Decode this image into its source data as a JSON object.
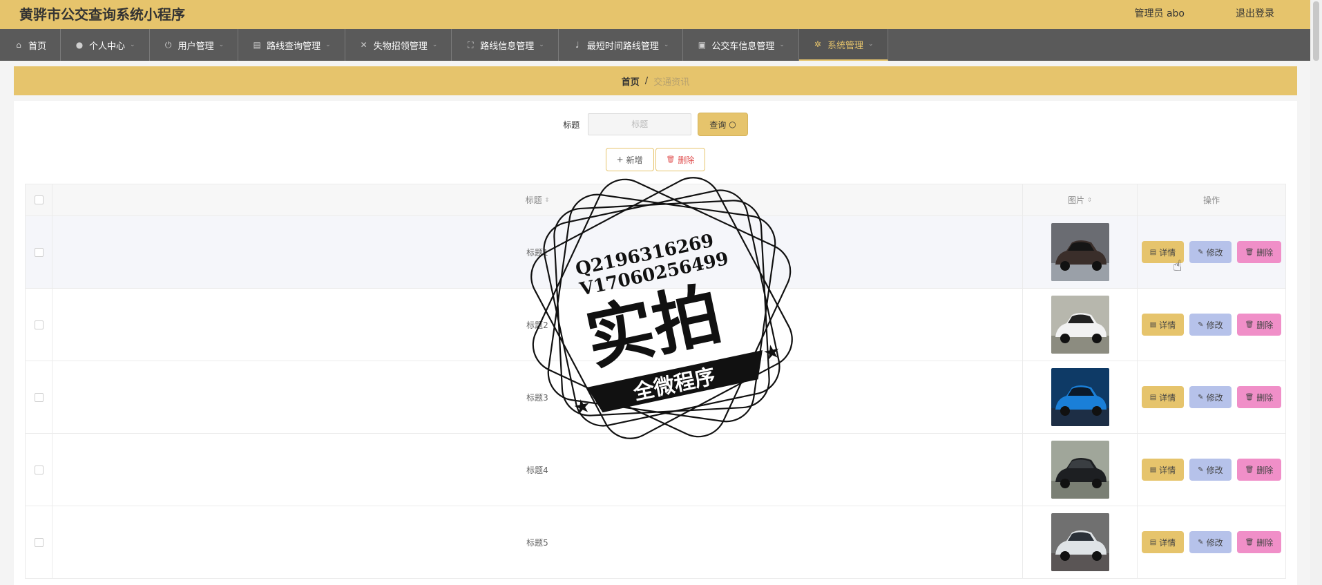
{
  "header": {
    "title": "黄骅市公交查询系统小程序",
    "user": "管理员 abo",
    "logout": "退出登录"
  },
  "nav": [
    {
      "label": "首页",
      "icon": "home-icon",
      "glyph": "⌂",
      "chevron": false,
      "active": false
    },
    {
      "label": "个人中心",
      "icon": "user-icon",
      "glyph": "●",
      "chevron": true,
      "active": false
    },
    {
      "label": "用户管理",
      "icon": "power-icon",
      "glyph": "⏻",
      "chevron": true,
      "active": false
    },
    {
      "label": "路线查询管理",
      "icon": "briefcase-icon",
      "glyph": "▤",
      "chevron": true,
      "active": false
    },
    {
      "label": "失物招领管理",
      "icon": "bell-off-icon",
      "glyph": "✕",
      "chevron": true,
      "active": false
    },
    {
      "label": "路线信息管理",
      "icon": "fullscreen-icon",
      "glyph": "⛶",
      "chevron": true,
      "active": false
    },
    {
      "label": "最短时间路线管理",
      "icon": "microphone-icon",
      "glyph": "♩",
      "chevron": true,
      "active": false
    },
    {
      "label": "公交车信息管理",
      "icon": "suitcase-icon",
      "glyph": "▣",
      "chevron": true,
      "active": false
    },
    {
      "label": "系统管理",
      "icon": "setting-icon",
      "glyph": "✲",
      "chevron": true,
      "active": true
    }
  ],
  "breadcrumb": {
    "home": "首页",
    "sep": "/",
    "current": "交通资讯"
  },
  "search": {
    "label": "标题",
    "placeholder": "标题",
    "button": "查询"
  },
  "actions": {
    "add": "新增",
    "delete": "删除"
  },
  "table": {
    "headers": {
      "title": "标题",
      "image": "图片",
      "operations": "操作"
    },
    "rows": [
      {
        "title": "标题1",
        "image": "dark-car"
      },
      {
        "title": "标题2",
        "image": "white-car"
      },
      {
        "title": "标题3",
        "image": "blue-car"
      },
      {
        "title": "标题4",
        "image": "black-suv"
      },
      {
        "title": "标题5",
        "image": "silver-car"
      }
    ],
    "ops": {
      "detail": "详情",
      "edit": "修改",
      "delete": "删除"
    }
  },
  "watermark": {
    "line1": "Q2196316269",
    "line2": "V17060256499",
    "big": "实拍",
    "banner": "全微程序"
  },
  "colors": {
    "accent": "#e6c46c",
    "nav": "#5a5a5a",
    "edit": "#b6c2ea",
    "delete": "#f08fc8"
  }
}
